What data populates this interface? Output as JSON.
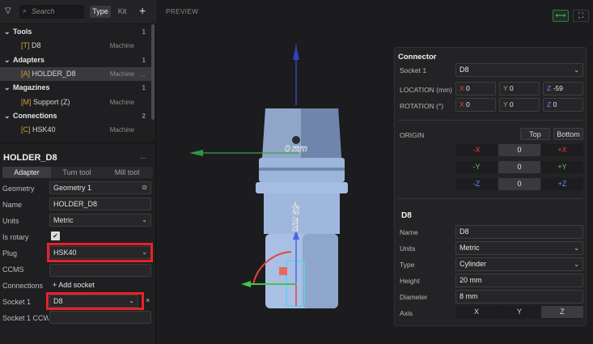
{
  "toolbar": {
    "search_placeholder": "Search",
    "type_label": "Type",
    "kit_label": "Kit",
    "add_label": "+"
  },
  "tree": [
    {
      "kind": "category",
      "label": "Tools",
      "count": "1"
    },
    {
      "kind": "item",
      "label": "[T] D8",
      "type": "Machine"
    },
    {
      "kind": "category",
      "label": "Adapters",
      "count": "1"
    },
    {
      "kind": "item",
      "label": "[A] HOLDER_D8",
      "type": "Machine",
      "selected": true,
      "more": "..."
    },
    {
      "kind": "category",
      "label": "Magazines",
      "count": "1"
    },
    {
      "kind": "item",
      "label": "[M] Support (Z)",
      "type": "Machine"
    },
    {
      "kind": "category",
      "label": "Connections",
      "count": "2"
    },
    {
      "kind": "item",
      "label": "[C] HSK40",
      "type": "Machine"
    }
  ],
  "props": {
    "title": "HOLDER_D8",
    "title_more": "...",
    "tabs": [
      "Adapter",
      "Turn tool",
      "Mill tool"
    ],
    "geometry_label": "Geometry",
    "geometry_value": "Geometry 1",
    "name_label": "Name",
    "name_value": "HOLDER_D8",
    "units_label": "Units",
    "units_value": "Metric",
    "rotary_label": "Is rotary",
    "rotary_check": "✔",
    "plug_label": "Plug",
    "plug_value": "HSK40",
    "ccms_label": "CCMS",
    "connections_label": "Connections",
    "add_socket": "+ Add socket",
    "socket1_label": "Socket 1",
    "socket1_value": "D8",
    "socket1_x": "×",
    "socket1_ccw_label": "Socket 1 CCW"
  },
  "viewport": {
    "title": "PREVIEW",
    "label_top": "0 mm",
    "label_side": "-59 mm",
    "accent_icon_color": "#4fbf6a"
  },
  "connector": {
    "title": "Connector",
    "socket_label": "Socket 1",
    "socket_value": "D8",
    "location_label": "LOCATION (mm)",
    "loc_x": "0",
    "loc_y": "0",
    "loc_z": "-59",
    "rotation_label": "ROTATION (°)",
    "rot_x": "0",
    "rot_y": "0",
    "rot_z": "0",
    "x": "X",
    "y": "Y",
    "z": "Z",
    "origin_label": "ORIGIN",
    "top_btn": "Top",
    "bottom_btn": "Bottom",
    "origin": [
      {
        "neg": "-X",
        "val": "0",
        "pos": "+X"
      },
      {
        "neg": "-Y",
        "val": "0",
        "pos": "+Y"
      },
      {
        "neg": "-Z",
        "val": "0",
        "pos": "+Z"
      }
    ]
  },
  "tool": {
    "title": "D8",
    "name_label": "Name",
    "name_value": "D8",
    "units_label": "Units",
    "units_value": "Metric",
    "type_label": "Type",
    "type_value": "Cylinder",
    "height_label": "Height",
    "height_value": "20 mm",
    "diameter_label": "Diameter",
    "diameter_value": "8 mm",
    "axis_label": "Axis",
    "axis_options": [
      "X",
      "Y",
      "Z"
    ],
    "axis_selected": "Z"
  },
  "colors": {
    "x_axis": "#e2453b",
    "y_axis": "#62c65b",
    "z_axis": "#6b8cff",
    "highlight": "#e8212b"
  }
}
